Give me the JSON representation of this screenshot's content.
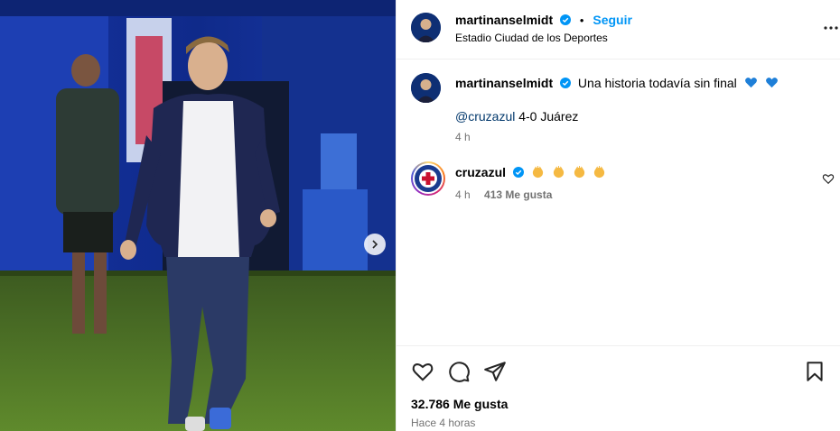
{
  "post": {
    "author": "martinanselmidt",
    "follow_label": "Seguir",
    "separator": "•",
    "location": "Estadio Ciudad de los Deportes"
  },
  "caption": {
    "author": "martinanselmidt",
    "text": "Una historia todavía sin final",
    "emojis": [
      "blue-heart",
      "blue-heart"
    ],
    "mention": "@cruzazul",
    "mention_rest": " 4-0 Juárez",
    "time": "4 h"
  },
  "comment": {
    "author": "cruzazul",
    "emojis": [
      "clapping-hands",
      "clapping-hands",
      "clapping-hands",
      "clapping-hands"
    ],
    "time": "4 h",
    "likes": "413 Me gusta"
  },
  "footer": {
    "likes": "32.786 Me gusta",
    "posted": "Hace 4 horas"
  },
  "colors": {
    "accent": "#0095f6",
    "verified": "#0095f6",
    "mention": "#00376b",
    "muted": "#737373",
    "heart_emoji": "#1e7fd8"
  },
  "icons": [
    "verified-badge-icon",
    "more-options-icon",
    "heart-icon",
    "comment-icon",
    "share-icon",
    "bookmark-icon",
    "chevron-right-icon"
  ]
}
